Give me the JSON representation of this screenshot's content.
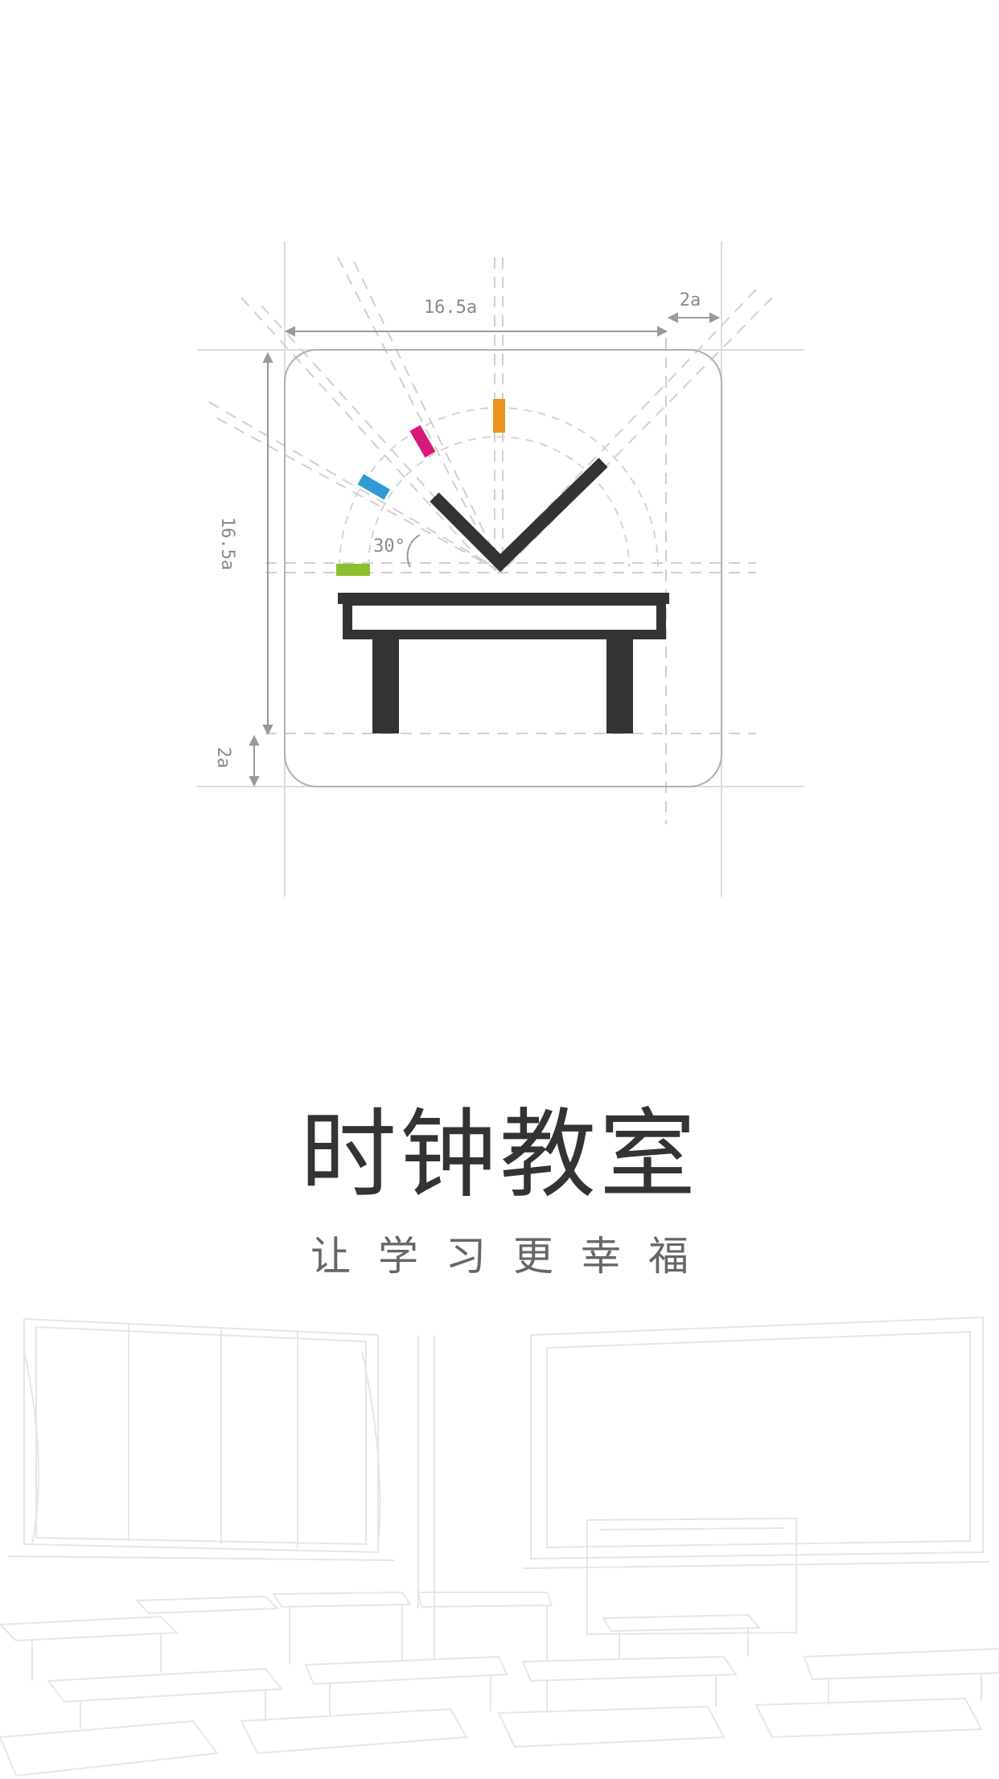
{
  "app": {
    "title": "时钟教室",
    "slogan": "让学习更幸福"
  },
  "logo": {
    "icon": "desk-with-checkmark-icon",
    "dimension_labels": {
      "top_width": "16.5a",
      "right_margin": "2a",
      "left_height": "16.5a",
      "bottom_margin": "2a",
      "angle": "30°"
    },
    "colors": {
      "green": "#8dbf2c",
      "blue": "#2e9bd6",
      "magenta": "#d61a7c",
      "orange": "#ea951c",
      "ink": "#333333",
      "guide": "#9a9a9a"
    }
  },
  "background": {
    "illustration": "classroom-line-drawing"
  }
}
